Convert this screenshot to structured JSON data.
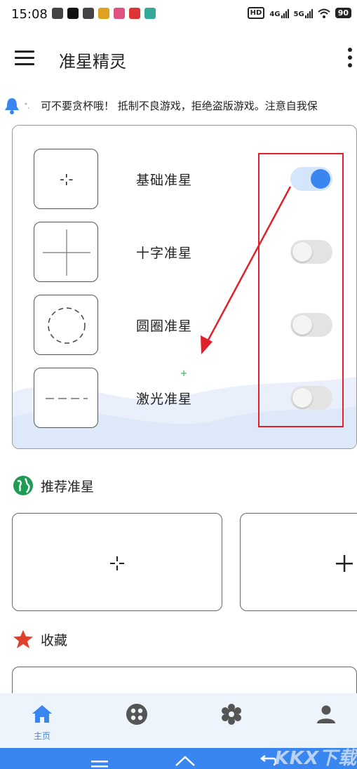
{
  "status_bar": {
    "time": "15:08",
    "hd_badge": "HD",
    "net_4g": "4G",
    "net_5g": "5G",
    "battery": "90"
  },
  "app_bar": {
    "title": "准星精灵"
  },
  "notice": {
    "text": "可不要贪杯哦！ 抵制不良游戏，拒绝盗版游戏。注意自我保"
  },
  "crosshairs": [
    {
      "label": "基础准星",
      "enabled": true,
      "style": "dot"
    },
    {
      "label": "十字准星",
      "enabled": false,
      "style": "cross"
    },
    {
      "label": "圆圈准星",
      "enabled": false,
      "style": "circle"
    },
    {
      "label": "激光准星",
      "enabled": false,
      "style": "laser"
    }
  ],
  "recommend": {
    "title": "推荐准星"
  },
  "favorites": {
    "title": "收藏"
  },
  "bottom_nav": {
    "items": [
      {
        "label": "主页",
        "icon": "home-icon",
        "active": true
      },
      {
        "label": "",
        "icon": "gamepad-icon",
        "active": false
      },
      {
        "label": "",
        "icon": "gear-icon",
        "active": false
      },
      {
        "label": "",
        "icon": "person-icon",
        "active": false
      }
    ]
  },
  "watermark": "KKX下载",
  "colors": {
    "accent": "#3a86f0",
    "annotation": "#e0202a",
    "toggle_off": "#e3e3e3",
    "nav_bg": "#eef4fc"
  }
}
